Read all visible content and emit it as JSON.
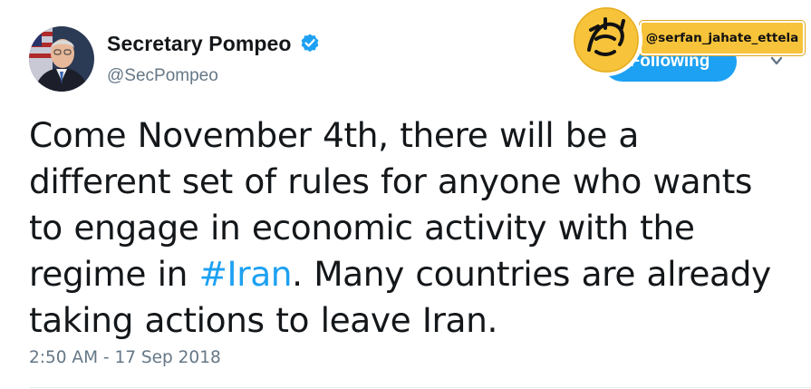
{
  "author": {
    "display_name": "Secretary Pompeo",
    "handle": "@SecPompeo",
    "avatar_icon": "portrait-avatar",
    "verified_icon": "verified-badge-icon"
  },
  "follow_button": {
    "label": "Following"
  },
  "tweet": {
    "text_before": "Come November 4th, there will be a different set of rules for anyone who wants to engage in economic activity with the regime in ",
    "hashtag": "#Iran",
    "text_after": ". Many countries are already taking actions to leave Iran.",
    "timestamp": "2:50 AM - 17 Sep 2018"
  },
  "watermark": {
    "handle": "@serfan_jahate_ettela",
    "logo_text": "صرفا جهت اطلاع"
  },
  "colors": {
    "link_blue": "#1da1f2",
    "secondary_text": "#657786",
    "primary_text": "#14171a",
    "watermark_yellow": "#f6c33a"
  }
}
